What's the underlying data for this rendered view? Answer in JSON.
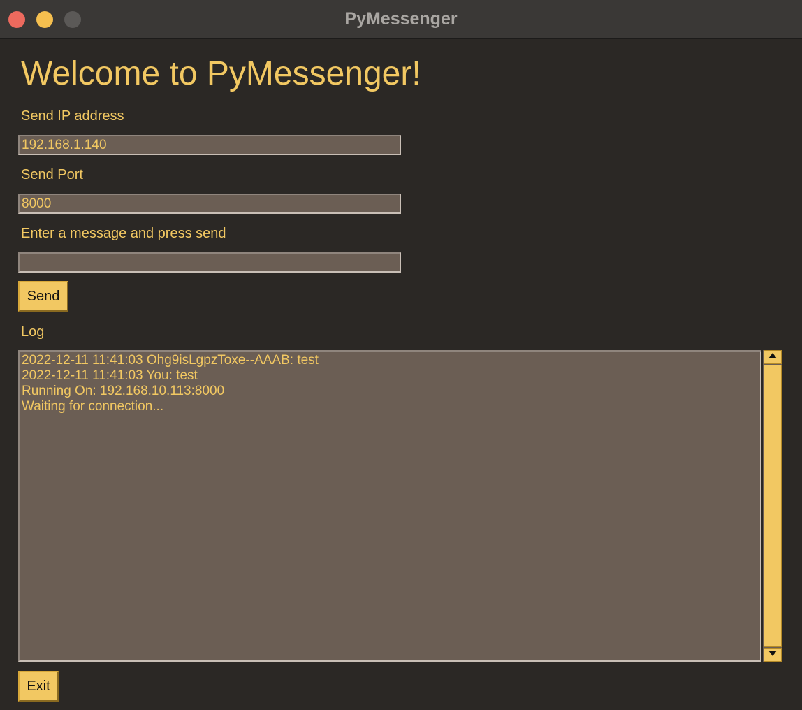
{
  "window": {
    "title": "PyMessenger"
  },
  "main": {
    "heading": "Welcome to PyMessenger!",
    "ip_label": "Send IP address",
    "ip_value": "192.168.1.140",
    "port_label": "Send Port",
    "port_value": "8000",
    "message_label": "Enter a message and press send",
    "message_value": "",
    "send_label": "Send",
    "log_label": "Log",
    "log_lines": [
      "2022-12-11 11:41:03 Ohg9isLgpzToxe--AAAB: test",
      "2022-12-11 11:41:03 You: test",
      "Running On: 192.168.10.113:8000",
      "Waiting for connection..."
    ],
    "exit_label": "Exit"
  },
  "icons": [
    "close-icon",
    "minimize-icon",
    "zoom-icon",
    "arrow-up-icon",
    "arrow-down-icon"
  ],
  "colors": {
    "background": "#2b2825",
    "accent": "#f2c862",
    "field_bg": "#6b5e54",
    "titlebar": "#3a3836"
  }
}
